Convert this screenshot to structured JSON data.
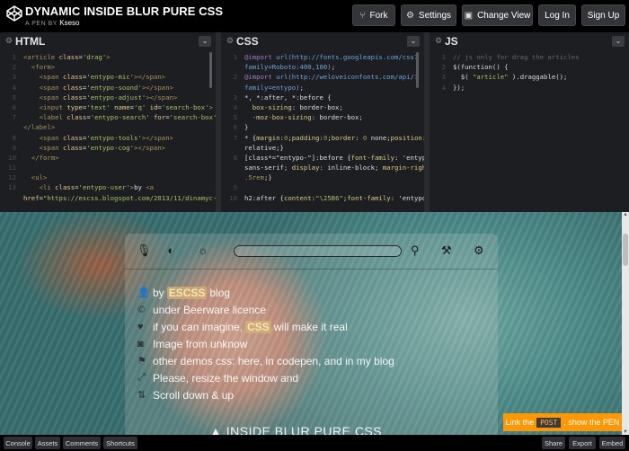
{
  "header": {
    "title": "DYNAMIC INSIDE BLUR PURE CSS",
    "subtitle_prefix": "A PEN BY",
    "author": "Kseso",
    "buttons": {
      "fork": "Fork",
      "settings": "Settings",
      "change_view": "Change View",
      "login": "Log In",
      "signup": "Sign Up"
    }
  },
  "editors": {
    "html": {
      "label": "HTML"
    },
    "css": {
      "label": "CSS"
    },
    "js": {
      "label": "JS"
    }
  },
  "preview": {
    "list": [
      {
        "icon": "user-icon",
        "pre": "by",
        "hl": "ESCSS",
        "post": "blog"
      },
      {
        "icon": "cc-icon",
        "pre": "under Beerware licence",
        "hl": "",
        "post": ""
      },
      {
        "icon": "heart-icon",
        "pre": "if you can imagine,",
        "hl": "CSS",
        "post": "will make it real"
      },
      {
        "icon": "camera-icon",
        "pre": "Image from unknow",
        "hl": "",
        "post": ""
      },
      {
        "icon": "signpost-icon",
        "pre": "other demos css: here, in codepen, and in my blog",
        "hl": "",
        "post": ""
      },
      {
        "icon": "resize-icon",
        "pre": "Please, resize the window and",
        "hl": "",
        "post": ""
      },
      {
        "icon": "scroll-icon",
        "pre": "Scroll down & up",
        "hl": "",
        "post": ""
      }
    ],
    "big_title": "▲ INSIDE BLUR PURE CSS",
    "post_link": {
      "pre": "Link the",
      "post_word": "POST",
      "post": ", show the PEN"
    }
  },
  "footer": {
    "left": [
      "Console",
      "Assets",
      "Comments",
      "Shortcuts"
    ],
    "right": [
      "Share",
      "Export",
      "Embed"
    ]
  },
  "colors": {
    "accent": "#ff9800",
    "header_bg": "#000000",
    "editor_bg": "#1d1e22"
  }
}
